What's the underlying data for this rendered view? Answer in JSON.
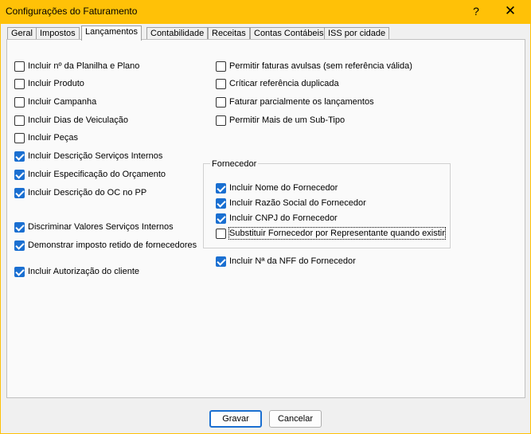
{
  "window": {
    "title": "Configurações do Faturamento",
    "help_glyph": "?",
    "close_glyph": "✕",
    "accent_color": "#ffc107"
  },
  "tabs": [
    {
      "label": "Geral"
    },
    {
      "label": "Impostos"
    },
    {
      "label": "Lançamentos"
    },
    {
      "label": "Contabilidade"
    },
    {
      "label": "Receitas"
    },
    {
      "label": "Contas Contábeis"
    },
    {
      "label": "ISS por cidade"
    }
  ],
  "left_column": [
    {
      "label": "Incluir nº da Planilha e Plano",
      "checked": false
    },
    {
      "label": "Incluir Produto",
      "checked": false
    },
    {
      "label": "Incluir Campanha",
      "checked": false
    },
    {
      "label": "Incluir Dias de Veiculação",
      "checked": false
    },
    {
      "label": "Incluir Peças",
      "checked": false
    },
    {
      "label": "Incluir Descrição Serviços Internos",
      "checked": true
    },
    {
      "label": "Incluir Especificação do Orçamento",
      "checked": true
    },
    {
      "label": "Incluir Descrição do OC no PP",
      "checked": true
    },
    {
      "label": "Discriminar Valores Serviços Internos",
      "checked": true
    },
    {
      "label": "Demonstrar imposto retido de fornecedores",
      "checked": true
    },
    {
      "label": "Incluir Autorização do cliente",
      "checked": true
    }
  ],
  "right_column": [
    {
      "label": "Permitir faturas avulsas (sem referência válida)",
      "checked": false
    },
    {
      "label": "Críticar referência duplicada",
      "checked": false
    },
    {
      "label": "Faturar parcialmente os lançamentos",
      "checked": false
    },
    {
      "label": "Permitir Mais de um Sub-Tipo",
      "checked": false
    }
  ],
  "fornecedor_group": {
    "title": "Fornecedor",
    "items": [
      {
        "label": "Incluir Nome do Fornecedor",
        "checked": true
      },
      {
        "label": "Incluir Razão Social do Fornecedor",
        "checked": true
      },
      {
        "label": "Incluir CNPJ do Fornecedor",
        "checked": true
      },
      {
        "label": "Substituir Fornecedor por Representante quando existir",
        "checked": false
      }
    ]
  },
  "nff_option": {
    "label": "Incluir Nª da NFF do Fornecedor",
    "checked": true
  },
  "buttons": {
    "save": "Gravar",
    "cancel": "Cancelar"
  }
}
